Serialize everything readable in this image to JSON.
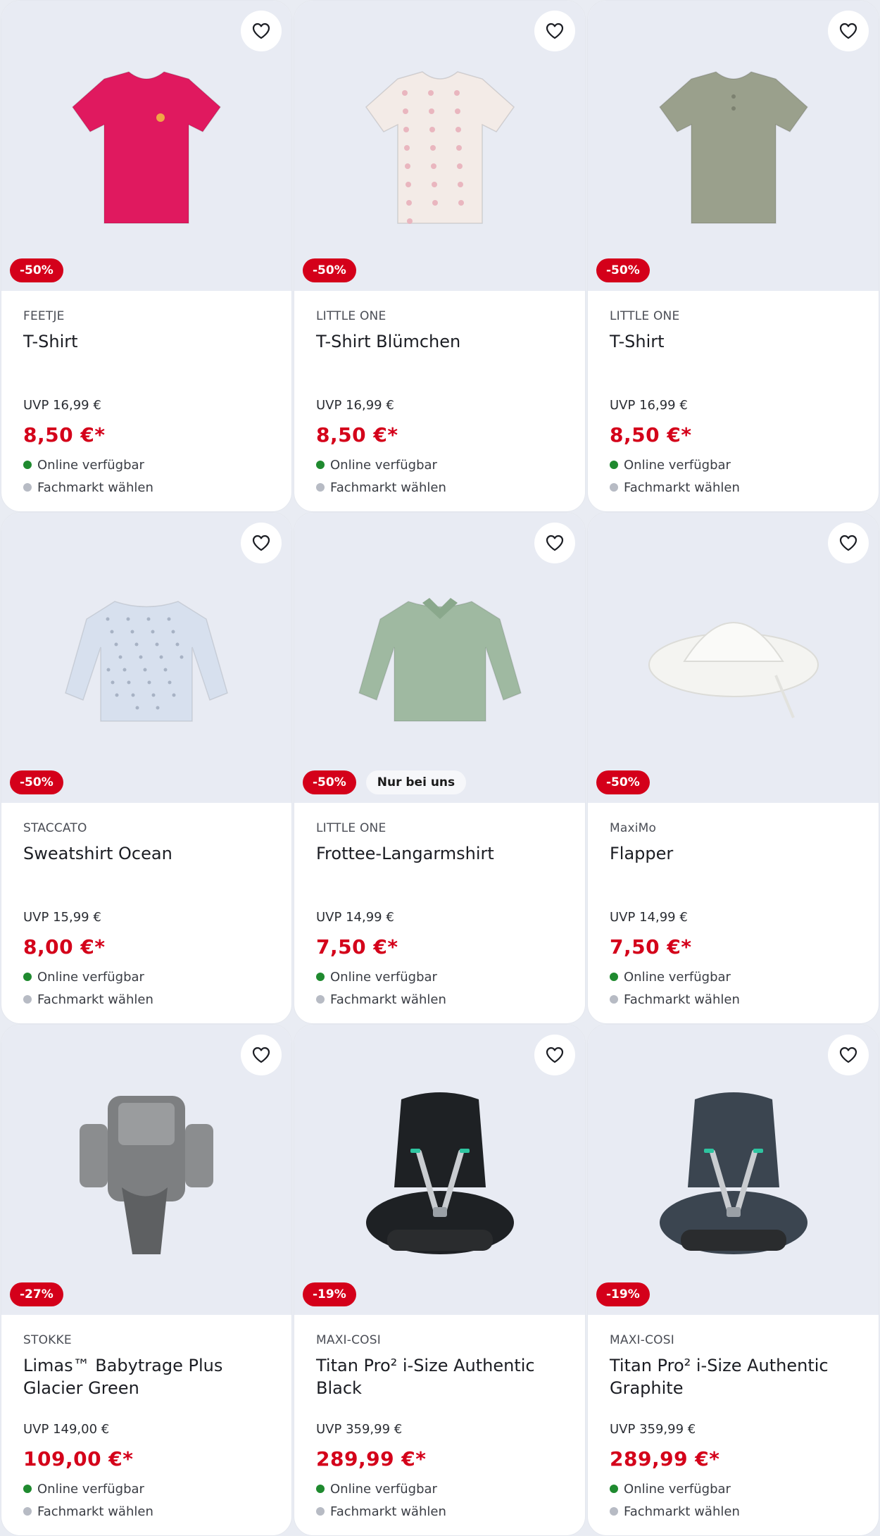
{
  "products": [
    {
      "brand": "FEETJE",
      "name": "T-Shirt",
      "uvp": "UVP 16,99 €",
      "price": "8,50 €*",
      "discount": "-50%",
      "badge": "",
      "online": "Online verfügbar",
      "store": "Fachmarkt wählen",
      "image": "tshirt-ruffle",
      "color": "#e0195f"
    },
    {
      "brand": "LITTLE ONE",
      "name": "T-Shirt Blümchen",
      "uvp": "UVP 16,99 €",
      "price": "8,50 €*",
      "discount": "-50%",
      "badge": "",
      "online": "Online verfügbar",
      "store": "Fachmarkt wählen",
      "image": "tshirt-flowers",
      "color": "#f3ebe7"
    },
    {
      "brand": "LITTLE ONE",
      "name": "T-Shirt",
      "uvp": "UVP 16,99 €",
      "price": "8,50 €*",
      "discount": "-50%",
      "badge": "",
      "online": "Online verfügbar",
      "store": "Fachmarkt wählen",
      "image": "tshirt-henley",
      "color": "#9aa08c"
    },
    {
      "brand": "STACCATO",
      "name": "Sweatshirt Ocean",
      "uvp": "UVP 15,99 €",
      "price": "8,00 €*",
      "discount": "-50%",
      "badge": "",
      "online": "Online verfügbar",
      "store": "Fachmarkt wählen",
      "image": "sweatshirt",
      "color": "#d7e0ee"
    },
    {
      "brand": "LITTLE ONE",
      "name": "Frottee-Langarmshirt",
      "uvp": "UVP 14,99 €",
      "price": "7,50 €*",
      "discount": "-50%",
      "badge": "Nur bei uns",
      "online": "Online verfügbar",
      "store": "Fachmarkt wählen",
      "image": "longsleeve",
      "color": "#9fb9a1"
    },
    {
      "brand": "MaxiMo",
      "name": "Flapper",
      "uvp": "UVP 14,99 €",
      "price": "7,50 €*",
      "discount": "-50%",
      "badge": "",
      "online": "Online verfügbar",
      "store": "Fachmarkt wählen",
      "image": "sun-hat",
      "color": "#f4f4f1"
    },
    {
      "brand": "STOKKE",
      "name": "Limas™ Babytrage Plus Glacier Green",
      "uvp": "UVP 149,00 €",
      "price": "109,00 €*",
      "discount": "-27%",
      "badge": "",
      "online": "Online verfügbar",
      "store": "Fachmarkt wählen",
      "image": "baby-carrier",
      "color": "#7d7f81"
    },
    {
      "brand": "MAXI-COSI",
      "name": "Titan Pro² i-Size Authentic Black",
      "uvp": "UVP 359,99 €",
      "price": "289,99 €*",
      "discount": "-19%",
      "badge": "",
      "online": "Online verfügbar",
      "store": "Fachmarkt wählen",
      "image": "car-seat",
      "color": "#1e2124"
    },
    {
      "brand": "MAXI-COSI",
      "name": "Titan Pro² i-Size Authentic Graphite",
      "uvp": "UVP 359,99 €",
      "price": "289,99 €*",
      "discount": "-19%",
      "badge": "",
      "online": "Online verfügbar",
      "store": "Fachmarkt wählen",
      "image": "car-seat",
      "color": "#3b4550"
    }
  ]
}
